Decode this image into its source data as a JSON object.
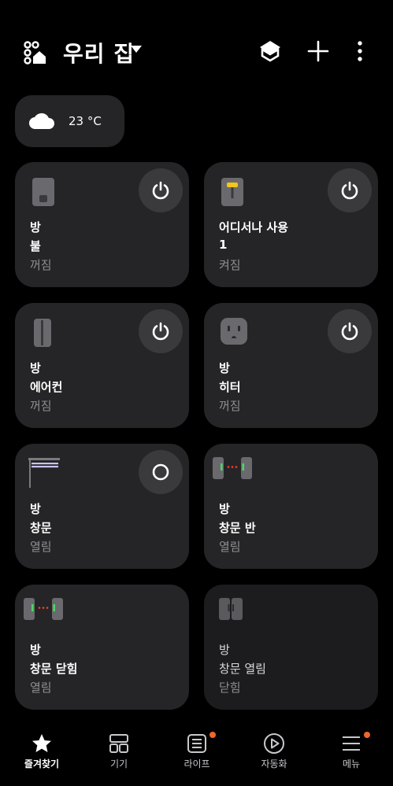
{
  "header": {
    "title": "우리 집"
  },
  "weather": {
    "temperature": "23 °C",
    "icon": "cloud-icon"
  },
  "devices": [
    {
      "room": "방",
      "name": "불",
      "state": "꺼짐",
      "icon": "switch-off-icon",
      "control": "power-icon"
    },
    {
      "room": "어디서나 사용",
      "name": "1",
      "state": "켜짐",
      "icon": "switch-on-icon",
      "control": "power-icon"
    },
    {
      "room": "방",
      "name": "에어컨",
      "state": "꺼짐",
      "icon": "air-conditioner-icon",
      "control": "power-icon"
    },
    {
      "room": "방",
      "name": "히터",
      "state": "꺼짐",
      "icon": "outlet-icon",
      "control": "power-icon"
    },
    {
      "room": "방",
      "name": "창문",
      "state": "열림",
      "icon": "blind-icon",
      "control": "circle-icon"
    },
    {
      "room": "방",
      "name": "창문 반",
      "state": "열림",
      "icon": "contact-sensor-open-icon"
    },
    {
      "room": "방",
      "name": "창문 닫힘",
      "state": "열림",
      "icon": "contact-sensor-open-icon"
    },
    {
      "room": "방",
      "name": "창문 열림",
      "state": "닫힘",
      "icon": "contact-sensor-closed-icon"
    }
  ],
  "nav": [
    {
      "label": "즐겨찾기",
      "icon": "star-icon",
      "active": true
    },
    {
      "label": "기기",
      "icon": "devices-grid-icon"
    },
    {
      "label": "라이프",
      "icon": "life-icon",
      "badge": true
    },
    {
      "label": "자동화",
      "icon": "play-circle-icon"
    },
    {
      "label": "메뉴",
      "icon": "menu-icon",
      "badge": true
    }
  ],
  "colors": {
    "accent": "#f0672a",
    "card_bg": "#252527",
    "card_off_bg": "#1c1c1e",
    "switch_on": "#f5c518",
    "sensor_light": "#4cd964",
    "sensor_gap": "#ff3b30",
    "blind": "#c8c4f5"
  }
}
